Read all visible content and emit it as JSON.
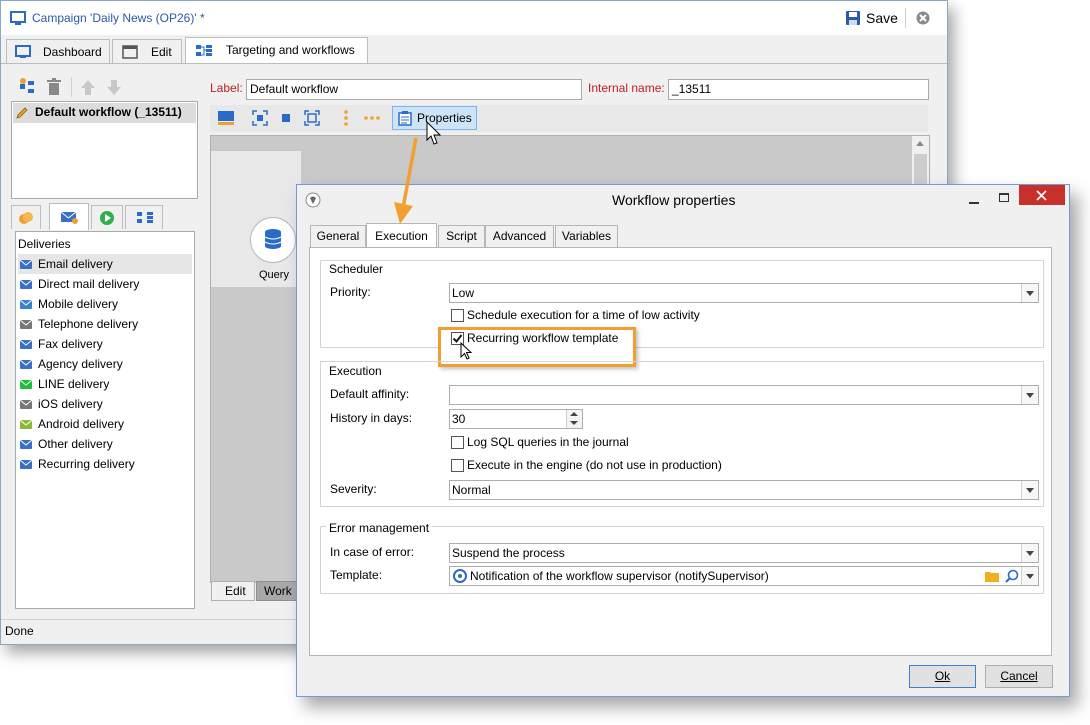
{
  "window": {
    "title": "Campaign 'Daily News (OP26)' *",
    "save_label": "Save",
    "status": "Done"
  },
  "main_tabs": [
    {
      "label": "Dashboard"
    },
    {
      "label": "Edit"
    },
    {
      "label": "Targeting and workflows"
    }
  ],
  "workflow_list": {
    "items": [
      {
        "label": "Default workflow (_13511)"
      }
    ]
  },
  "form": {
    "label_caption": "Label:",
    "label_value": "Default workflow",
    "internal_caption": "Internal name:",
    "internal_value": "_13511",
    "properties_button": "Properties"
  },
  "canvas": {
    "query_label": "Query",
    "bottom_tabs": [
      {
        "label": "Edit"
      },
      {
        "label": "Work"
      }
    ]
  },
  "deliveries": {
    "header": "Deliveries",
    "items": [
      {
        "label": "Email delivery",
        "icon": "email-icon",
        "color": "#3a6fc4"
      },
      {
        "label": "Direct mail delivery",
        "icon": "direct-mail-icon",
        "color": "#3a6fc4"
      },
      {
        "label": "Mobile delivery",
        "icon": "sms-icon",
        "color": "#3a7fd0"
      },
      {
        "label": "Telephone delivery",
        "icon": "telephone-icon",
        "color": "#777777"
      },
      {
        "label": "Fax delivery",
        "icon": "fax-icon",
        "color": "#3a6fc4"
      },
      {
        "label": "Agency delivery",
        "icon": "agency-icon",
        "color": "#3a6fc4"
      },
      {
        "label": "LINE delivery",
        "icon": "line-icon",
        "color": "#1dbf3a"
      },
      {
        "label": "iOS delivery",
        "icon": "apple-icon",
        "color": "#777777"
      },
      {
        "label": "Android delivery",
        "icon": "android-icon",
        "color": "#8cb83a"
      },
      {
        "label": "Other delivery",
        "icon": "other-delivery-icon",
        "color": "#3a6fc4"
      },
      {
        "label": "Recurring delivery",
        "icon": "recurring-delivery-icon",
        "color": "#3a6fc4"
      }
    ]
  },
  "dialog": {
    "title": "Workflow properties",
    "tabs": [
      {
        "label": "General"
      },
      {
        "label": "Execution"
      },
      {
        "label": "Script"
      },
      {
        "label": "Advanced"
      },
      {
        "label": "Variables"
      }
    ],
    "scheduler": {
      "legend": "Scheduler",
      "priority_label": "Priority:",
      "priority_value": "Low",
      "low_activity_label": "Schedule execution for a time of low activity",
      "low_activity_checked": false,
      "recurring_label": "Recurring workflow template",
      "recurring_checked": true
    },
    "execution": {
      "legend": "Execution",
      "affinity_label": "Default affinity:",
      "affinity_value": "",
      "history_label": "History in days:",
      "history_value": "30",
      "log_sql_label": "Log SQL queries in the journal",
      "log_sql_checked": false,
      "engine_label": "Execute in the engine (do not use in production)",
      "engine_checked": false,
      "severity_label": "Severity:",
      "severity_value": "Normal"
    },
    "errors": {
      "legend": "Error management",
      "case_label": "In case of error:",
      "case_value": "Suspend the process",
      "template_label": "Template:",
      "template_value": "Notification of the workflow supervisor (notifySupervisor)"
    },
    "ok_label": "Ok",
    "cancel_label": "Cancel"
  },
  "colors": {
    "highlight": "#f0a030",
    "accent": "#1f5fbf"
  }
}
